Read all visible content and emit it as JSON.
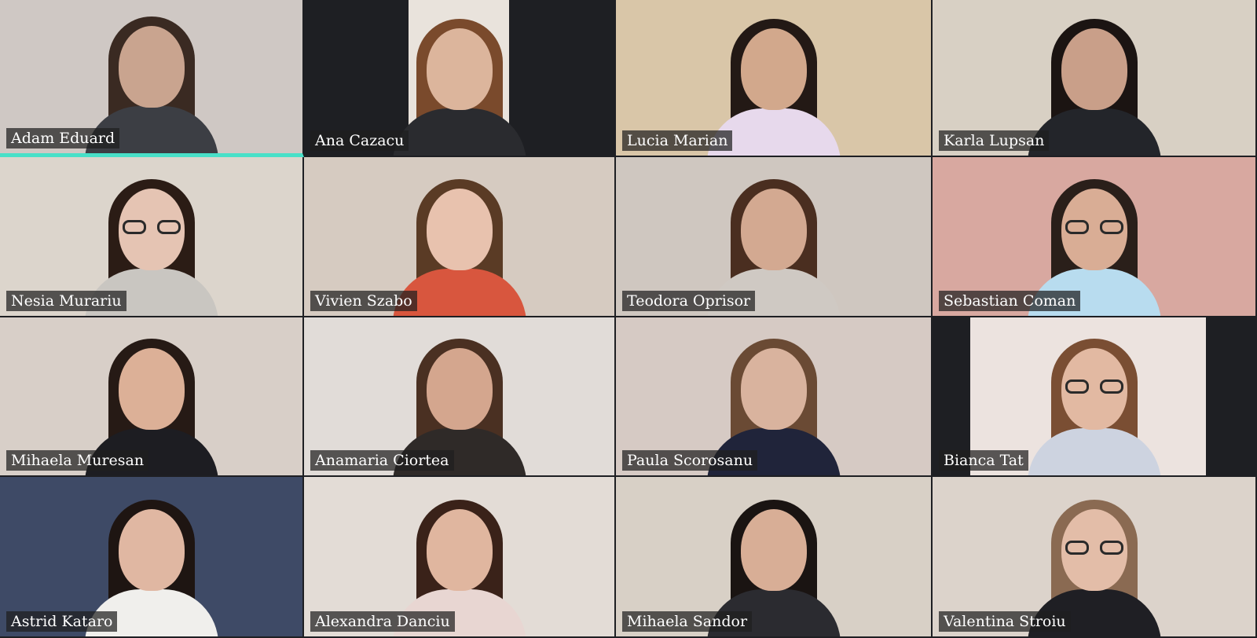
{
  "meeting": {
    "view": "gallery",
    "active_speaker": "Adam Eduard",
    "accent_color": "#48e0c8",
    "participants": [
      {
        "name": "Adam Eduard",
        "bg": "#cfc8c4",
        "skin": "#c9a48f",
        "hair": "#3a2a22",
        "shirt": "#3c3e44",
        "glasses": false,
        "active": true
      },
      {
        "name": "Ana Cazacu",
        "bg": "#1e1f23",
        "skin": "#dcb59c",
        "hair": "#7a4a2c",
        "shirt": "#2a2b2f",
        "glasses": false,
        "inset": "#e9e3dc"
      },
      {
        "name": "Lucia Marian",
        "bg": "#d9c6a8",
        "skin": "#d2a88c",
        "hair": "#231915",
        "shirt": "#e7d9ec",
        "glasses": false
      },
      {
        "name": "Karla Lupsan",
        "bg": "#d8d0c4",
        "skin": "#c99f89",
        "hair": "#1b1412",
        "shirt": "#23252a",
        "glasses": false
      },
      {
        "name": "Nesia Murariu",
        "bg": "#dcd5cc",
        "skin": "#e5c4b3",
        "hair": "#2b1c15",
        "shirt": "#c9c6c1",
        "glasses": true
      },
      {
        "name": "Vivien Szabo",
        "bg": "#d6cbc1",
        "skin": "#e8c2ae",
        "hair": "#5a3b25",
        "shirt": "#d8563e",
        "glasses": false
      },
      {
        "name": "Teodora Oprisor",
        "bg": "#cfc7c0",
        "skin": "#d3a991",
        "hair": "#4a2e20",
        "shirt": "#cfc9c3",
        "glasses": false
      },
      {
        "name": "Sebastian Coman",
        "bg": "#d8a8a0",
        "skin": "#d9ad95",
        "hair": "#2a1f1a",
        "shirt": "#b8dcef",
        "glasses": true
      },
      {
        "name": "Mihaela Muresan",
        "bg": "#d8cfc8",
        "skin": "#dcb097",
        "hair": "#261a15",
        "shirt": "#1d1d22",
        "glasses": false
      },
      {
        "name": "Anamaria Ciortea",
        "bg": "#e1dcd8",
        "skin": "#d4a68e",
        "hair": "#4a3022",
        "shirt": "#2f2a28",
        "glasses": false
      },
      {
        "name": "Paula Scorosanu",
        "bg": "#d6cac4",
        "skin": "#d9b39e",
        "hair": "#6a4a34",
        "shirt": "#20243a",
        "glasses": false
      },
      {
        "name": "Bianca Tat",
        "bg": "#1e1f23",
        "skin": "#e2b9a2",
        "hair": "#7a4e33",
        "shirt": "#cdd3e0",
        "glasses": true,
        "inset": "#ece3df"
      },
      {
        "name": "Astrid Kataro",
        "bg": "#3e4a66",
        "skin": "#e0b7a2",
        "hair": "#1e1512",
        "shirt": "#f0efec",
        "glasses": false
      },
      {
        "name": "Alexandra Danciu",
        "bg": "#e3dcd6",
        "skin": "#e0b69f",
        "hair": "#3a2219",
        "shirt": "#e8d6d2",
        "glasses": false
      },
      {
        "name": "Mihaela Sandor",
        "bg": "#d8d0c6",
        "skin": "#d8ae96",
        "hair": "#1a1412",
        "shirt": "#2b2b30",
        "glasses": false
      },
      {
        "name": "Valentina Stroiu",
        "bg": "#dcd3cb",
        "skin": "#e3bda8",
        "hair": "#8a6a52",
        "shirt": "#1f1f24",
        "glasses": true
      }
    ]
  }
}
